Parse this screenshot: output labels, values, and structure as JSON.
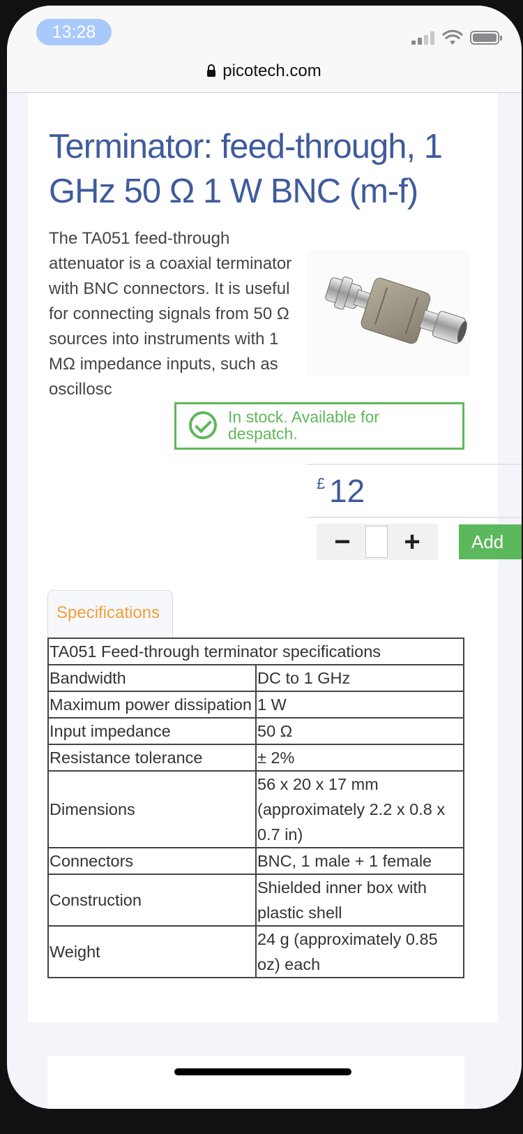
{
  "status": {
    "time": "13:28"
  },
  "browser": {
    "url": "picotech.com"
  },
  "product": {
    "title": "Terminator: feed-through, 1 GHz 50 Ω 1 W BNC (m-f)",
    "description": "The TA051 feed-through attenuator is a coaxial terminator with BNC connectors. It is useful for connecting signals from 50 Ω sources into instruments with 1 MΩ impedance inputs, such as oscillosc",
    "stock": "In stock. Available for despatch.",
    "currency": "£",
    "price": "12",
    "add_label": "Add",
    "minus": "−",
    "plus": "+"
  },
  "tabs": [
    {
      "label": "Specifications",
      "active": true
    }
  ],
  "specs": {
    "caption": "TA051 Feed-through terminator specifications",
    "rows": [
      {
        "key": "Bandwidth",
        "value": "DC to 1 GHz"
      },
      {
        "key": "Maximum power dissipation",
        "value": "1 W"
      },
      {
        "key": "Input impedance",
        "value": "50 Ω"
      },
      {
        "key": "Resistance tolerance",
        "value": "± 2%"
      },
      {
        "key": "Dimensions",
        "value": "56 x 20 x 17 mm  (approximately 2.2 x 0.8 x 0.7 in)"
      },
      {
        "key": "Connectors",
        "value": "BNC, 1 male + 1 female"
      },
      {
        "key": "Construction",
        "value": "Shielded inner box with plastic shell"
      },
      {
        "key": "Weight",
        "value": "24 g  (approximately 0.85 oz) each"
      }
    ]
  },
  "icons": {
    "secure": "lock-icon",
    "stock": "check-circle-icon"
  },
  "colors": {
    "title": "#3f5b9c",
    "stock": "#5fb85a",
    "tab_label": "#f0a038",
    "add_button": "#5cb85c"
  }
}
